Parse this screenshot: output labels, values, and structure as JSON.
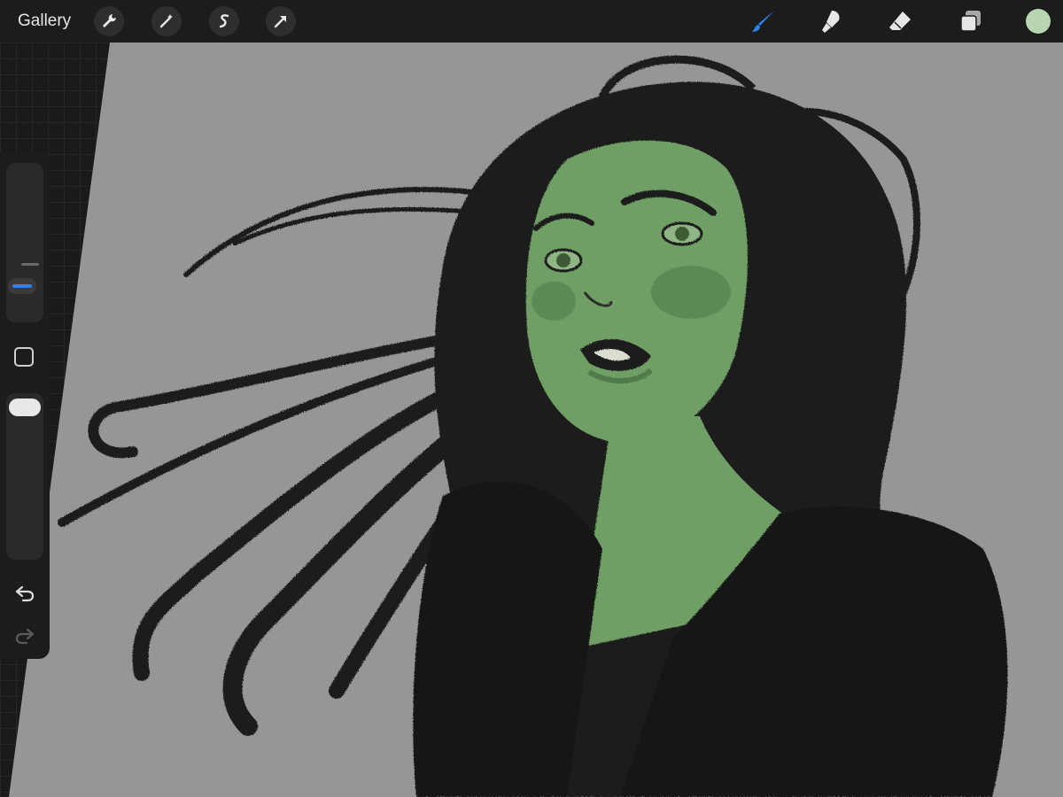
{
  "topbar": {
    "gallery_label": "Gallery",
    "left_tools": [
      "wrench-icon",
      "magic-wand-icon",
      "selection-icon",
      "transform-arrow-icon"
    ],
    "right_tools": [
      "brush-icon",
      "smudge-icon",
      "eraser-icon",
      "layers-icon"
    ],
    "active_tool": "brush-icon",
    "current_color": "#b8d4b0"
  },
  "colors": {
    "accent": "#2b83f6",
    "canvas_gray": "#969696",
    "skin_green": "#6b9a63",
    "hair_black": "#1b1b1b"
  },
  "sidebar": {
    "controls": [
      "brush-size-slider",
      "modify-button",
      "opacity-slider",
      "undo-button",
      "redo-button"
    ]
  }
}
